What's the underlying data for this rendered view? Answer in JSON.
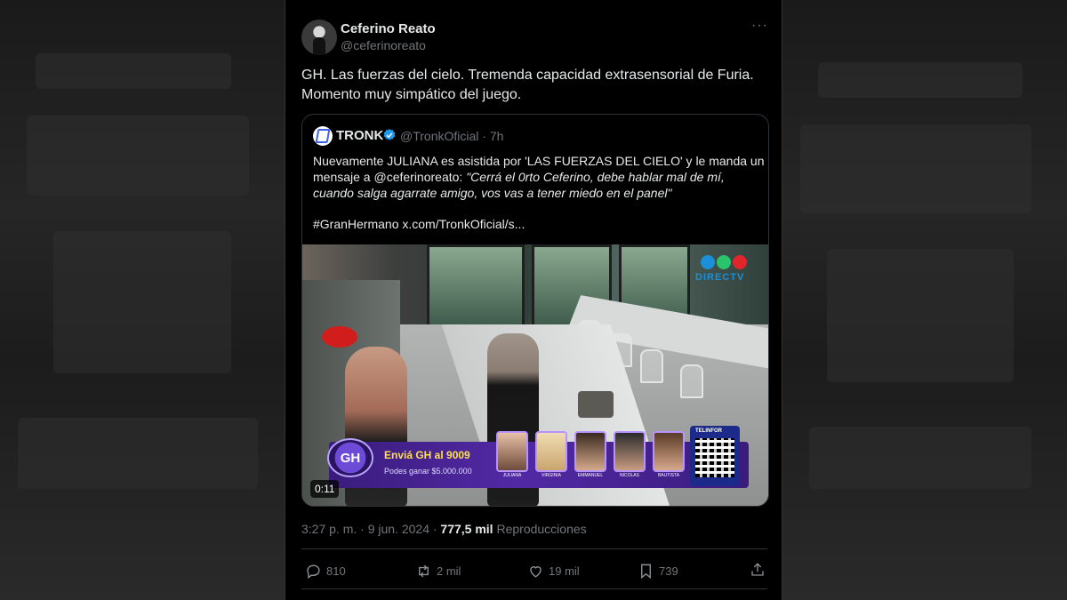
{
  "author": {
    "name": "Ceferino Reato",
    "handle": "@ceferinoreato"
  },
  "tweet_text": "GH. Las fuerzas del cielo. Tremenda capacidad extrasensorial de Furia. Momento muy simpático del juego.",
  "quote": {
    "name": "TRONK",
    "handle_time": "@TronkOficial · 7h",
    "text_plain": "Nuevamente JULIANA es asistida por 'LAS FUERZAS DEL CIELO' y le manda un mensaje a @ceferinoreato: ",
    "text_italic": "\"Cerrá el 0rto Ceferino, debe hablar mal de mí, cuando salga agarrate amigo, vos vas a tener miedo en el panel\"",
    "tags": "#GranHermano  x.com/TronkOficial/s..."
  },
  "media": {
    "duration": "0:11",
    "channel_logo_text": "DIRECTV",
    "banner_title": "Enviá GH al 9009",
    "banner_sub": "Podes ganar $5.000.000",
    "gh_label": "GH",
    "qr_label": "TELINFOR",
    "candidates": [
      "JULIANA",
      "VIRGINIA",
      "EMMANUEL",
      "NICOLAS",
      "BAUTISTA"
    ]
  },
  "meta": {
    "time_date": "3:27 p. m. · 9 jun. 2024 · ",
    "views": "777,5 mil",
    "views_label": " Reproducciones"
  },
  "actions": {
    "replies": "810",
    "reposts": "2 mil",
    "likes": "19 mil",
    "bookmarks": "739"
  },
  "colors": {
    "background": "#000000",
    "text": "#e7e9ea",
    "muted": "#71767b",
    "verified": "#1d9bf0"
  }
}
